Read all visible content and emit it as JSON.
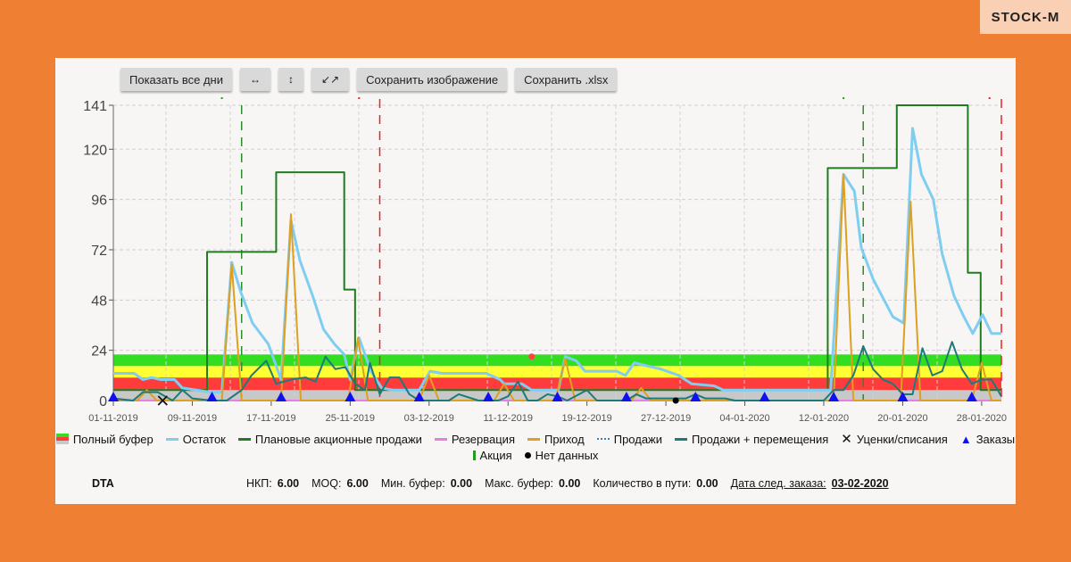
{
  "brand": {
    "logo_text": "STOCK-M"
  },
  "toolbar": {
    "show_all_days": "Показать все дни",
    "zoom_x": "↔",
    "zoom_y": "↕",
    "zoom_reset": "↙↗",
    "save_image": "Сохранить изображение",
    "save_xlsx": "Сохранить .xlsx"
  },
  "legend": {
    "full_buffer": "Полный буфер",
    "stock": "Остаток",
    "planned_promo_sales": "Плановые акционные продажи",
    "reservation": "Резервация",
    "arrival": "Приход",
    "sales": "Продажи",
    "sales_moves": "Продажи + перемещения",
    "markdowns": "Уценки/списания",
    "orders": "Заказы",
    "promo": "Акция",
    "no_data": "Нет данных"
  },
  "info": {
    "label": "DTA",
    "nkp_label": "НКП:",
    "nkp": "6.00",
    "moq_label": "MOQ:",
    "moq": "6.00",
    "min_buf_label": "Мин. буфер:",
    "min_buf": "0.00",
    "max_buf_label": "Макс. буфер:",
    "max_buf": "0.00",
    "in_transit_label": "Количество в пути:",
    "in_transit": "0.00",
    "next_order_label": "Дата след. заказа:",
    "next_order": "03-02-2020"
  },
  "chart_data": {
    "type": "line",
    "xlabel": "",
    "ylabel": "",
    "x_unit": "days since 01-11-2019",
    "xlim": [
      0,
      90
    ],
    "ylim": [
      0,
      141
    ],
    "yticks": [
      0,
      24,
      48,
      72,
      96,
      120,
      141
    ],
    "xticks": [
      {
        "day": 0,
        "label": "01-11-2019"
      },
      {
        "day": 8,
        "label": "09-11-2019"
      },
      {
        "day": 16,
        "label": "17-11-2019"
      },
      {
        "day": 24,
        "label": "25-11-2019"
      },
      {
        "day": 32,
        "label": "03-12-2019"
      },
      {
        "day": 40,
        "label": "11-12-2019"
      },
      {
        "day": 48,
        "label": "19-12-2019"
      },
      {
        "day": 56,
        "label": "27-12-2019"
      },
      {
        "day": 64,
        "label": "04-01-2020"
      },
      {
        "day": 72,
        "label": "12-01-2020"
      },
      {
        "day": 80,
        "label": "20-01-2020"
      },
      {
        "day": 88,
        "label": "28-01-2020"
      }
    ],
    "grid": true,
    "buffer_zones": [
      {
        "zone": "gray",
        "from": 0,
        "to": 5,
        "color": "#c8c8c8"
      },
      {
        "zone": "red",
        "from": 5,
        "to": 11,
        "color": "#ff3c3c"
      },
      {
        "zone": "yellow",
        "from": 11,
        "to": 16.5,
        "color": "#ffff33"
      },
      {
        "zone": "green",
        "from": 16.5,
        "to": 22,
        "color": "#33dd22"
      }
    ],
    "series": [
      {
        "name": "Плановые акционные продажи",
        "color": "#1e7d1e",
        "step": true,
        "points": [
          [
            0,
            5
          ],
          [
            9.5,
            5
          ],
          [
            9.5,
            71
          ],
          [
            16.5,
            71
          ],
          [
            16.5,
            109
          ],
          [
            23.4,
            109
          ],
          [
            23.4,
            53
          ],
          [
            24.5,
            53
          ],
          [
            24.5,
            5
          ],
          [
            72.4,
            5
          ],
          [
            72.4,
            111
          ],
          [
            79.4,
            111
          ],
          [
            79.4,
            141
          ],
          [
            86.6,
            141
          ],
          [
            86.6,
            61
          ],
          [
            87.9,
            61
          ],
          [
            87.9,
            5
          ],
          [
            90,
            5
          ]
        ]
      },
      {
        "name": "Остаток",
        "color": "#80cdf2",
        "points": [
          [
            0,
            13
          ],
          [
            2.1,
            13
          ],
          [
            3,
            10
          ],
          [
            3.9,
            11
          ],
          [
            4.8,
            10
          ],
          [
            6.2,
            10
          ],
          [
            7,
            6
          ],
          [
            8.4,
            5
          ],
          [
            9.8,
            4
          ],
          [
            11,
            4
          ],
          [
            12,
            66
          ],
          [
            12.9,
            52
          ],
          [
            14.1,
            37
          ],
          [
            15.7,
            27
          ],
          [
            17,
            10
          ],
          [
            18,
            86
          ],
          [
            18.9,
            67
          ],
          [
            20.2,
            50
          ],
          [
            21.3,
            34
          ],
          [
            22.4,
            27
          ],
          [
            23.4,
            22
          ],
          [
            24,
            10
          ],
          [
            24.9,
            30
          ],
          [
            26.1,
            14
          ],
          [
            27.2,
            6
          ],
          [
            28.3,
            5
          ],
          [
            31,
            5
          ],
          [
            32.1,
            14
          ],
          [
            33.3,
            13
          ],
          [
            37.8,
            13
          ],
          [
            39.2,
            10
          ],
          [
            39.6,
            8
          ],
          [
            41.4,
            8
          ],
          [
            42.4,
            5
          ],
          [
            45.1,
            5
          ],
          [
            45.8,
            21
          ],
          [
            46.9,
            19
          ],
          [
            47.8,
            14
          ],
          [
            51,
            14
          ],
          [
            51.9,
            12
          ],
          [
            52.8,
            18
          ],
          [
            55.5,
            15
          ],
          [
            57.3,
            12
          ],
          [
            58.6,
            8
          ],
          [
            60.9,
            7
          ],
          [
            61.8,
            5
          ],
          [
            72.7,
            5
          ],
          [
            74,
            108
          ],
          [
            75.1,
            100
          ],
          [
            75.8,
            73
          ],
          [
            77,
            58
          ],
          [
            79,
            40
          ],
          [
            80.1,
            37
          ],
          [
            81,
            130
          ],
          [
            81.9,
            108
          ],
          [
            83.1,
            96
          ],
          [
            84,
            70
          ],
          [
            85.2,
            50
          ],
          [
            86.2,
            40
          ],
          [
            87.1,
            32
          ],
          [
            88.1,
            41
          ],
          [
            89,
            32
          ],
          [
            90,
            32
          ]
        ]
      },
      {
        "name": "Резервация",
        "color": "#e67ee6",
        "points": [
          [
            0,
            0
          ],
          [
            90,
            0
          ]
        ]
      },
      {
        "name": "Приход",
        "color": "#dda020",
        "points": [
          [
            0,
            0
          ],
          [
            2.4,
            0
          ],
          [
            3.4,
            5
          ],
          [
            4.4,
            0
          ],
          [
            11,
            0
          ],
          [
            12,
            65
          ],
          [
            13,
            0
          ],
          [
            17,
            0
          ],
          [
            18,
            89
          ],
          [
            19,
            0
          ],
          [
            23.8,
            0
          ],
          [
            24.8,
            30
          ],
          [
            25.8,
            0
          ],
          [
            31,
            0
          ],
          [
            32,
            12
          ],
          [
            33,
            0
          ],
          [
            38.6,
            0
          ],
          [
            39.6,
            8
          ],
          [
            40.6,
            0
          ],
          [
            44.8,
            0
          ],
          [
            45.8,
            20
          ],
          [
            46.8,
            0
          ],
          [
            52.5,
            0
          ],
          [
            53.5,
            6
          ],
          [
            54.5,
            0
          ],
          [
            73,
            0
          ],
          [
            74,
            108
          ],
          [
            75,
            0
          ],
          [
            79.8,
            0
          ],
          [
            80.8,
            95
          ],
          [
            81.8,
            0
          ],
          [
            87,
            0
          ],
          [
            88,
            18
          ],
          [
            89,
            0
          ],
          [
            90,
            0
          ]
        ]
      },
      {
        "name": "Продажи + перемещения",
        "color": "#1d7a7a",
        "points": [
          [
            0,
            1
          ],
          [
            2,
            0
          ],
          [
            3,
            4
          ],
          [
            4.5,
            4
          ],
          [
            6,
            0
          ],
          [
            7,
            5
          ],
          [
            8,
            1
          ],
          [
            10,
            0
          ],
          [
            11.5,
            0
          ],
          [
            13,
            5
          ],
          [
            14,
            12
          ],
          [
            15.5,
            19
          ],
          [
            16.5,
            8
          ],
          [
            18,
            10
          ],
          [
            19.5,
            11
          ],
          [
            20.5,
            9
          ],
          [
            21.5,
            21
          ],
          [
            22.5,
            15
          ],
          [
            23.5,
            16
          ],
          [
            24.5,
            8
          ],
          [
            25.5,
            5
          ],
          [
            26,
            18
          ],
          [
            27,
            3
          ],
          [
            28,
            11
          ],
          [
            29,
            11
          ],
          [
            30,
            3
          ],
          [
            31,
            0
          ],
          [
            34,
            0
          ],
          [
            35,
            3
          ],
          [
            37,
            0
          ],
          [
            39,
            0
          ],
          [
            40,
            2
          ],
          [
            41,
            9
          ],
          [
            42,
            0
          ],
          [
            43,
            0
          ],
          [
            44,
            3
          ],
          [
            45,
            2
          ],
          [
            46,
            0
          ],
          [
            48,
            5
          ],
          [
            49,
            0
          ],
          [
            52,
            0
          ],
          [
            53,
            3
          ],
          [
            54,
            1
          ],
          [
            58,
            1
          ],
          [
            59,
            3
          ],
          [
            60,
            1
          ],
          [
            62,
            1
          ],
          [
            63,
            0
          ],
          [
            72,
            0
          ],
          [
            73,
            5
          ],
          [
            74,
            5
          ],
          [
            75,
            12
          ],
          [
            76,
            26
          ],
          [
            77,
            15
          ],
          [
            78,
            10
          ],
          [
            79,
            8
          ],
          [
            80,
            3
          ],
          [
            81,
            3
          ],
          [
            82,
            25
          ],
          [
            83,
            12
          ],
          [
            84,
            14
          ],
          [
            85,
            28
          ],
          [
            86,
            15
          ],
          [
            87,
            8
          ],
          [
            88,
            10
          ],
          [
            89,
            10
          ],
          [
            90,
            2
          ]
        ]
      }
    ],
    "orders": [
      0,
      10,
      17,
      24,
      31,
      38,
      45,
      52,
      59,
      66,
      73,
      80,
      87
    ],
    "markdowns": [
      [
        5,
        0
      ]
    ],
    "no_data": [
      [
        57,
        0
      ]
    ],
    "outlier_point": [
      42.4,
      21
    ],
    "promo_markers": [
      11,
      74
    ],
    "promo_lines": [
      13,
      76
    ],
    "end_lines": [
      27,
      90
    ],
    "end_markers": [
      24.9,
      88.8
    ]
  }
}
